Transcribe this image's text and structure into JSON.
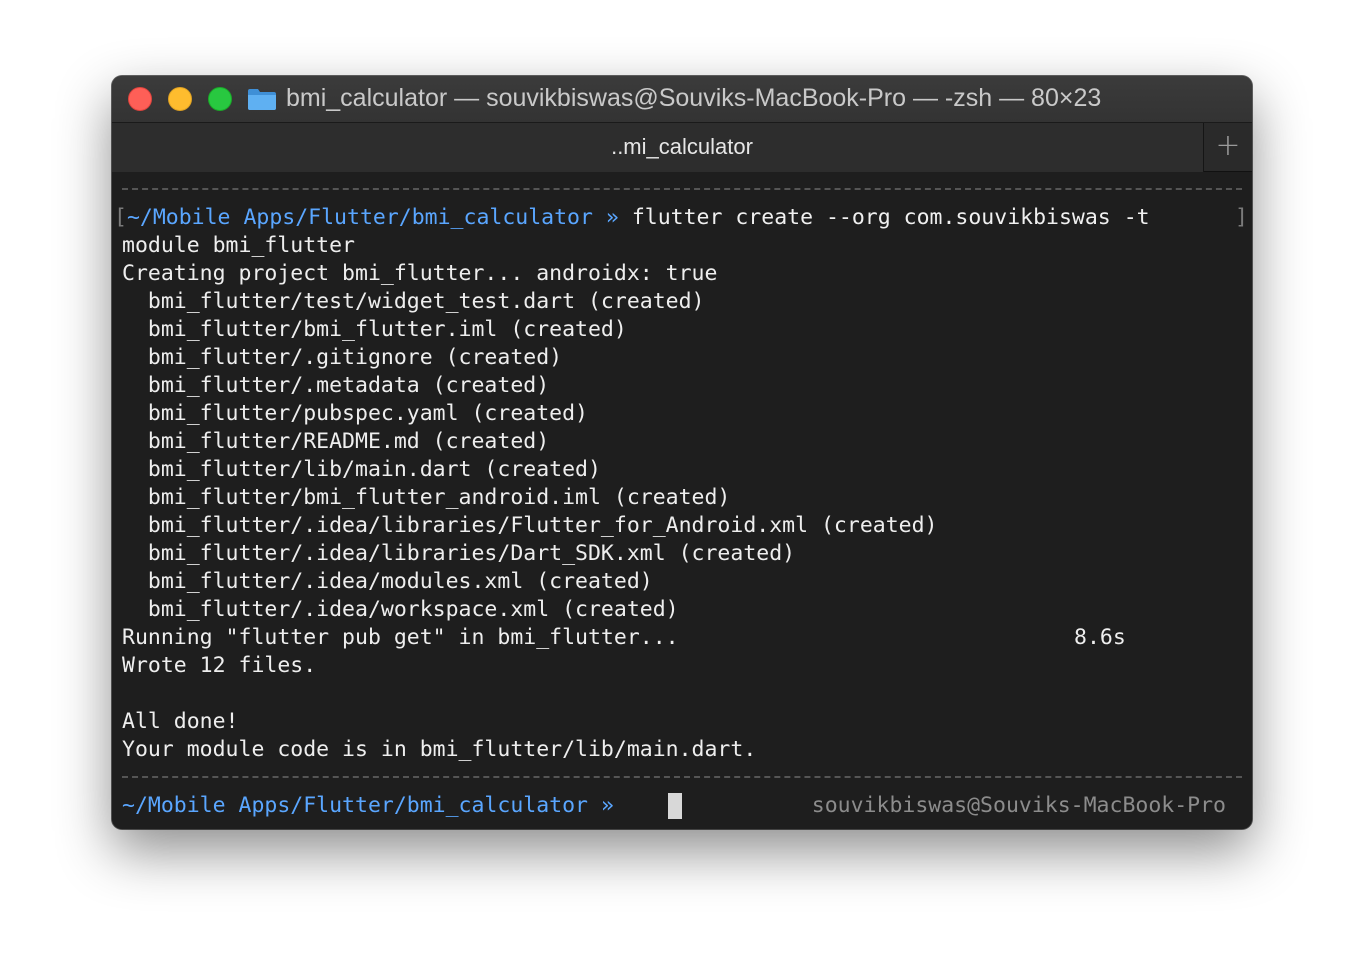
{
  "window": {
    "title": "bmi_calculator — souvikbiswas@Souviks-MacBook-Pro — -zsh — 80×23",
    "tab_label": "..mi_calculator",
    "add_tab_symbol": "+",
    "folder_icon": "folder-icon"
  },
  "colors": {
    "path": "#5aa6ff",
    "background": "#1e1e1e",
    "text": "#eeeeee"
  },
  "terminal": {
    "prompt_open_bracket": "[",
    "prompt_path": "~/Mobile Apps/Flutter/bmi_calculator",
    "prompt_arrow": "»",
    "command": "flutter create --org com.souvikbiswas -t",
    "prompt_close_bracket": "]",
    "command_wrap": "module bmi_flutter",
    "creating_line": "Creating project bmi_flutter... androidx: true",
    "created_files": [
      "  bmi_flutter/test/widget_test.dart (created)",
      "  bmi_flutter/bmi_flutter.iml (created)",
      "  bmi_flutter/.gitignore (created)",
      "  bmi_flutter/.metadata (created)",
      "  bmi_flutter/pubspec.yaml (created)",
      "  bmi_flutter/README.md (created)",
      "  bmi_flutter/lib/main.dart (created)",
      "  bmi_flutter/bmi_flutter_android.iml (created)",
      "  bmi_flutter/.idea/libraries/Flutter_for_Android.xml (created)",
      "  bmi_flutter/.idea/libraries/Dart_SDK.xml (created)",
      "  bmi_flutter/.idea/modules.xml (created)",
      "  bmi_flutter/.idea/workspace.xml (created)"
    ],
    "running_line": "Running \"flutter pub get\" in bmi_flutter...",
    "running_time": "8.6s",
    "wrote_line": "Wrote 12 files.",
    "all_done": "All done!",
    "module_code_line": "Your module code is in bmi_flutter/lib/main.dart.",
    "final_prompt_path": "~/Mobile Apps/Flutter/bmi_calculator",
    "final_prompt_arrow": "»",
    "right_prompt": "souvikbiswas@Souviks-MacBook-Pro"
  }
}
